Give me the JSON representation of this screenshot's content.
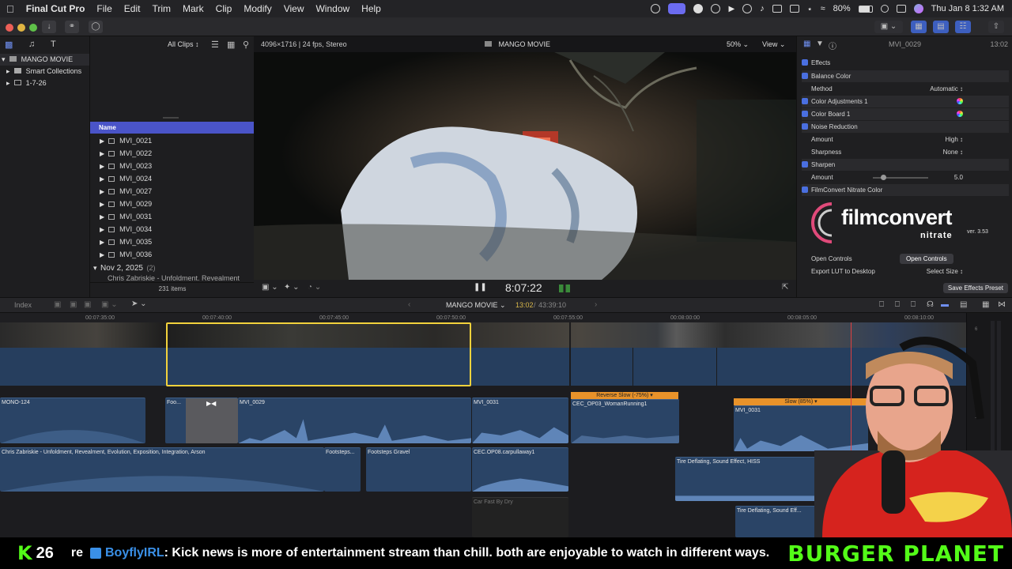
{
  "menubar": {
    "app_name": "Final Cut Pro",
    "items": [
      "File",
      "Edit",
      "Trim",
      "Mark",
      "Clip",
      "Modify",
      "View",
      "Window",
      "Help"
    ],
    "battery": "80%",
    "datetime": "Thu Jan 8  1:32 AM"
  },
  "library": {
    "name": "MANGO MOVIE",
    "items": [
      "Smart Collections",
      "1-7-26"
    ]
  },
  "browser": {
    "filter": "All Clips",
    "column_header": "Name",
    "clips": [
      "MVI_0021",
      "MVI_0022",
      "MVI_0023",
      "MVI_0024",
      "MVI_0027",
      "MVI_0029",
      "MVI_0031",
      "MVI_0034",
      "MVI_0035",
      "MVI_0036"
    ],
    "date_group": "Nov 2, 2025",
    "date_group_count": "(2)",
    "partial_item": "Chris Zabriskie - Unfoldment, Revealment",
    "item_count": "231 items"
  },
  "viewer": {
    "format_info": "4096×1716 | 24 fps, Stereo",
    "title": "MANGO MOVIE",
    "zoom": "50%",
    "view_label": "View",
    "timecode": "8:07:22"
  },
  "inspector": {
    "clip_name": "MVI_0029",
    "duration": "13:02",
    "section": "Effects",
    "rows": [
      {
        "label": "Balance Color",
        "checked": true,
        "value": ""
      },
      {
        "label": "Method",
        "checked": false,
        "value": "Automatic ↕"
      },
      {
        "label": "Color Adjustments 1",
        "checked": true,
        "value": ""
      },
      {
        "label": "Color Board 1",
        "checked": true,
        "value": ""
      },
      {
        "label": "Noise Reduction",
        "checked": true,
        "value": ""
      },
      {
        "label": "Amount",
        "checked": false,
        "value": "High ↕"
      },
      {
        "label": "Sharpness",
        "checked": false,
        "value": "None ↕"
      },
      {
        "label": "Sharpen",
        "checked": true,
        "value": ""
      },
      {
        "label": "Amount",
        "checked": false,
        "value": "5.0"
      },
      {
        "label": "FilmConvert Nitrate Color",
        "checked": true,
        "value": ""
      }
    ],
    "filmconvert_title": "filmconvert",
    "filmconvert_sub": "nitrate",
    "filmconvert_version": "ver. 3.53",
    "open_controls_label": "Open Controls",
    "open_controls_button": "Open Controls",
    "export_lut_label": "Export LUT to Desktop",
    "export_lut_value": "Select Size ↕",
    "save_preset": "Save Effects Preset"
  },
  "timeline": {
    "index_label": "Index",
    "project_name": "MANGO MOVIE",
    "position": "13:02",
    "total": "43:39:10",
    "ruler": [
      "00:07:35:00",
      "00:07:40:00",
      "00:07:45:00",
      "00:07:50:00",
      "00:07:55:00",
      "00:08:00:00",
      "00:08:05:00",
      "00:08:10:00"
    ],
    "clip_labels": {
      "mono": "MONO-124",
      "foo": "Foo...",
      "mvi0029": "MVI_0029",
      "mvi0031": "MVI_0031",
      "reverse_badge": "Reverse Slow (-75%) ▾",
      "woman_running": "CEC_OP03_WomanRunning1",
      "slow_badge": "Slow (85%) ▾",
      "mvi0031b": "MVI_0031",
      "music": "Chris Zabriskie - Unfoldment, Revealment, Evolution, Exposition, Integration, Arson",
      "footsteps1": "Footsteps...",
      "footsteps2": "Footsteps Gravel",
      "carpullaway": "CEC.OP08.carpullaway1",
      "tire1": "Tire Deflating, Sound Effect, HISS",
      "car_fast": "Car Fast By Dry",
      "tire2": "Tire Deflating, Sound Eff..."
    }
  },
  "ticker": {
    "count": "26",
    "prefix": "re",
    "username": "BoyflyIRL",
    "message": ": Kick news is more of entertainment stream than chill. both are enjoyable to watch in different ways.",
    "brand": "BURGER PLANET"
  },
  "colors": {
    "accent": "#4a6fe0",
    "clip_blue": "#2e4a6e",
    "selection": "#f2d23c",
    "retime_orange": "#e8922a",
    "ticker_green": "#53fc18"
  }
}
